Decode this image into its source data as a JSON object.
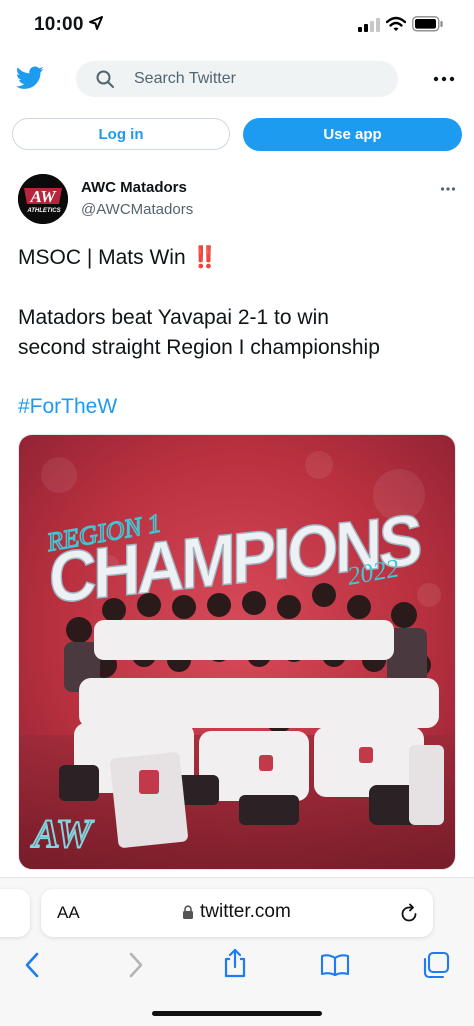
{
  "status_bar": {
    "time": "10:00"
  },
  "header": {
    "search_placeholder": "Search Twitter"
  },
  "auth": {
    "login_label": "Log in",
    "use_app_label": "Use app"
  },
  "tweet": {
    "author_name": "AWC Matadors",
    "author_handle": "@AWCMatadors",
    "line1": "MSOC | Mats Win",
    "emoji": "‼️",
    "line2": "Matadors beat Yavapai 2-1 to win",
    "line3": "second straight Region I championship",
    "hashtag": "#ForTheW"
  },
  "media": {
    "region_text": "REGION 1",
    "champions_text": "CHAMPIONS",
    "year_text": "2022",
    "logo_text": "AW"
  },
  "avatar": {
    "logo_text": "AW",
    "sub_text": "ATHLETICS"
  },
  "safari": {
    "aa_label": "AA",
    "url": "twitter.com"
  },
  "colors": {
    "twitter_blue": "#1d9bf0",
    "accent_red": "#c23a4a"
  }
}
